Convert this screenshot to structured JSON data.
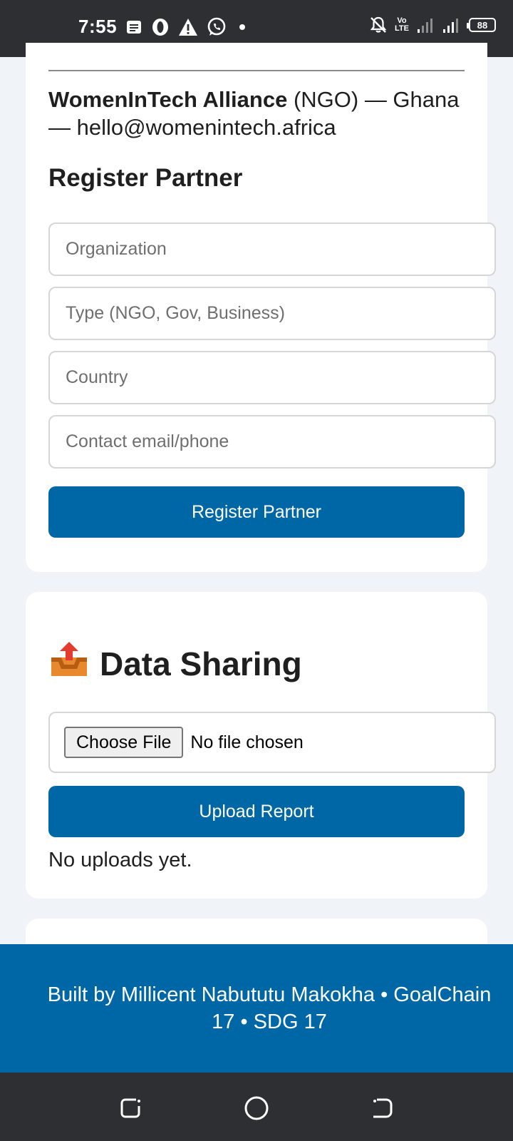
{
  "status_bar": {
    "time": "7:55",
    "left_icons": [
      "message-icon",
      "opera-icon",
      "warning-icon",
      "whatsapp-icon",
      "dot-icon"
    ],
    "network_top": "Vo",
    "network_bottom": "LTE",
    "network_type": "4G",
    "battery": "88"
  },
  "partner": {
    "name": "WomenInTech Alliance",
    "details": " (NGO) — Ghana — hello@womenintech.africa"
  },
  "register": {
    "title": "Register Partner",
    "org_placeholder": "Organization",
    "type_placeholder": "Type (NGO, Gov, Business)",
    "country_placeholder": "Country",
    "contact_placeholder": "Contact email/phone",
    "button_label": "Register Partner"
  },
  "data_sharing": {
    "title": "Data Sharing",
    "icon": "outbox-tray-icon",
    "choose_file_label": "Choose File",
    "file_status": "No file chosen",
    "upload_label": "Upload Report",
    "uploads_status": "No uploads yet."
  },
  "footer": {
    "line1": "Built by Millicent Nabututu Makokha • GoalChain",
    "line2": "17 • SDG 17"
  },
  "colors": {
    "primary": "#0067a6",
    "background": "#f0f3f7",
    "system_bar": "#2d2f33"
  }
}
